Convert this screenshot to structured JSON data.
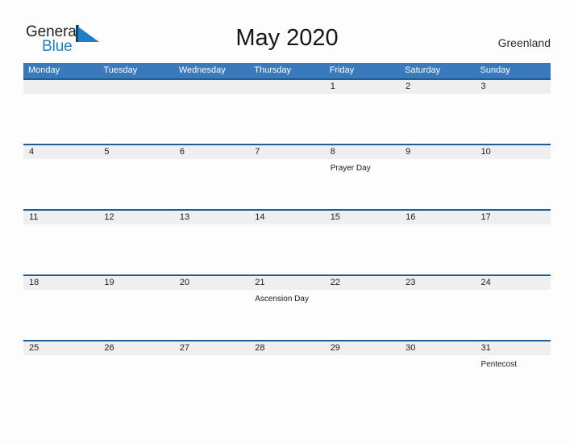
{
  "brand": {
    "name_part1": "General",
    "name_part2": "Blue",
    "flag_icon": "blue-triangle-flag",
    "color_dark": "#231f20",
    "color_blue": "#1f7fc4"
  },
  "header": {
    "title": "May 2020",
    "location": "Greenland"
  },
  "theme": {
    "header_bar": "#3b79bd",
    "row_divider": "#1f5c9e",
    "date_band": "#efefef",
    "page_background": "#fdfdfd"
  },
  "calendar": {
    "weekdays": [
      "Monday",
      "Tuesday",
      "Wednesday",
      "Thursday",
      "Friday",
      "Saturday",
      "Sunday"
    ],
    "weeks": [
      {
        "days": [
          {
            "date": "",
            "event": ""
          },
          {
            "date": "",
            "event": ""
          },
          {
            "date": "",
            "event": ""
          },
          {
            "date": "",
            "event": ""
          },
          {
            "date": "1",
            "event": ""
          },
          {
            "date": "2",
            "event": ""
          },
          {
            "date": "3",
            "event": ""
          }
        ]
      },
      {
        "days": [
          {
            "date": "4",
            "event": ""
          },
          {
            "date": "5",
            "event": ""
          },
          {
            "date": "6",
            "event": ""
          },
          {
            "date": "7",
            "event": ""
          },
          {
            "date": "8",
            "event": "Prayer Day"
          },
          {
            "date": "9",
            "event": ""
          },
          {
            "date": "10",
            "event": ""
          }
        ]
      },
      {
        "days": [
          {
            "date": "11",
            "event": ""
          },
          {
            "date": "12",
            "event": ""
          },
          {
            "date": "13",
            "event": ""
          },
          {
            "date": "14",
            "event": ""
          },
          {
            "date": "15",
            "event": ""
          },
          {
            "date": "16",
            "event": ""
          },
          {
            "date": "17",
            "event": ""
          }
        ]
      },
      {
        "days": [
          {
            "date": "18",
            "event": ""
          },
          {
            "date": "19",
            "event": ""
          },
          {
            "date": "20",
            "event": ""
          },
          {
            "date": "21",
            "event": "Ascension Day"
          },
          {
            "date": "22",
            "event": ""
          },
          {
            "date": "23",
            "event": ""
          },
          {
            "date": "24",
            "event": ""
          }
        ]
      },
      {
        "days": [
          {
            "date": "25",
            "event": ""
          },
          {
            "date": "26",
            "event": ""
          },
          {
            "date": "27",
            "event": ""
          },
          {
            "date": "28",
            "event": ""
          },
          {
            "date": "29",
            "event": ""
          },
          {
            "date": "30",
            "event": ""
          },
          {
            "date": "31",
            "event": "Pentecost"
          }
        ]
      }
    ]
  }
}
